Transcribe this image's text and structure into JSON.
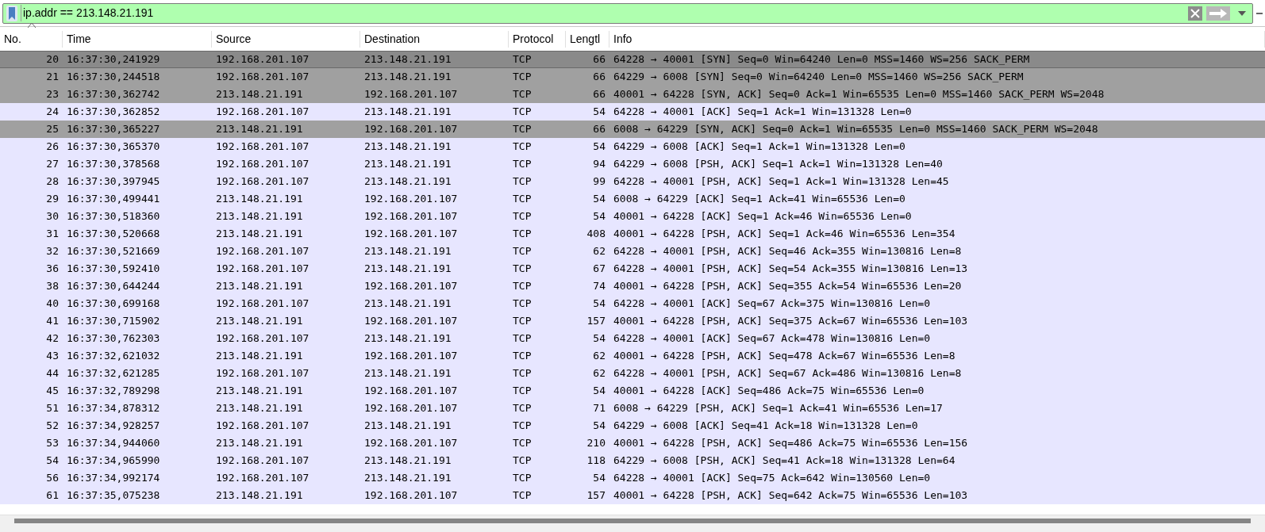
{
  "filter": {
    "value": "ip.addr == 213.148.21.191"
  },
  "table": {
    "columns": [
      "No.",
      "Time",
      "Source",
      "Destination",
      "Protocol",
      "Lengtl",
      "Info"
    ],
    "rows": [
      {
        "cells": [
          "20",
          "16:37:30,241929",
          "192.168.201.107",
          "213.148.21.191",
          "TCP",
          "66",
          "64228 → 40001 [SYN] Seq=0 Win=64240 Len=0 MSS=1460 WS=256 SACK_PERM"
        ],
        "color": "#8a8a8a",
        "selected": true
      },
      {
        "cells": [
          "21",
          "16:37:30,244518",
          "192.168.201.107",
          "213.148.21.191",
          "TCP",
          "66",
          "64229 → 6008 [SYN] Seq=0 Win=64240 Len=0 MSS=1460 WS=256 SACK_PERM"
        ],
        "color": "#a0a0a0",
        "selected": false
      },
      {
        "cells": [
          "23",
          "16:37:30,362742",
          "213.148.21.191",
          "192.168.201.107",
          "TCP",
          "66",
          "40001 → 64228 [SYN, ACK] Seq=0 Ack=1 Win=65535 Len=0 MSS=1460 SACK_PERM WS=2048"
        ],
        "color": "#a0a0a0",
        "selected": false
      },
      {
        "cells": [
          "24",
          "16:37:30,362852",
          "192.168.201.107",
          "213.148.21.191",
          "TCP",
          "54",
          "64228 → 40001 [ACK] Seq=1 Ack=1 Win=131328 Len=0"
        ],
        "color": "#e7e6ff",
        "selected": false
      },
      {
        "cells": [
          "25",
          "16:37:30,365227",
          "213.148.21.191",
          "192.168.201.107",
          "TCP",
          "66",
          "6008 → 64229 [SYN, ACK] Seq=0 Ack=1 Win=65535 Len=0 MSS=1460 SACK_PERM WS=2048"
        ],
        "color": "#a0a0a0",
        "selected": false
      },
      {
        "cells": [
          "26",
          "16:37:30,365370",
          "192.168.201.107",
          "213.148.21.191",
          "TCP",
          "54",
          "64229 → 6008 [ACK] Seq=1 Ack=1 Win=131328 Len=0"
        ],
        "color": "#e7e6ff",
        "selected": false
      },
      {
        "cells": [
          "27",
          "16:37:30,378568",
          "192.168.201.107",
          "213.148.21.191",
          "TCP",
          "94",
          "64229 → 6008 [PSH, ACK] Seq=1 Ack=1 Win=131328 Len=40"
        ],
        "color": "#e7e6ff",
        "selected": false
      },
      {
        "cells": [
          "28",
          "16:37:30,397945",
          "192.168.201.107",
          "213.148.21.191",
          "TCP",
          "99",
          "64228 → 40001 [PSH, ACK] Seq=1 Ack=1 Win=131328 Len=45"
        ],
        "color": "#e7e6ff",
        "selected": false
      },
      {
        "cells": [
          "29",
          "16:37:30,499441",
          "213.148.21.191",
          "192.168.201.107",
          "TCP",
          "54",
          "6008 → 64229 [ACK] Seq=1 Ack=41 Win=65536 Len=0"
        ],
        "color": "#e7e6ff",
        "selected": false
      },
      {
        "cells": [
          "30",
          "16:37:30,518360",
          "213.148.21.191",
          "192.168.201.107",
          "TCP",
          "54",
          "40001 → 64228 [ACK] Seq=1 Ack=46 Win=65536 Len=0"
        ],
        "color": "#e7e6ff",
        "selected": false
      },
      {
        "cells": [
          "31",
          "16:37:30,520668",
          "213.148.21.191",
          "192.168.201.107",
          "TCP",
          "408",
          "40001 → 64228 [PSH, ACK] Seq=1 Ack=46 Win=65536 Len=354"
        ],
        "color": "#e7e6ff",
        "selected": false
      },
      {
        "cells": [
          "32",
          "16:37:30,521669",
          "192.168.201.107",
          "213.148.21.191",
          "TCP",
          "62",
          "64228 → 40001 [PSH, ACK] Seq=46 Ack=355 Win=130816 Len=8"
        ],
        "color": "#e7e6ff",
        "selected": false
      },
      {
        "cells": [
          "36",
          "16:37:30,592410",
          "192.168.201.107",
          "213.148.21.191",
          "TCP",
          "67",
          "64228 → 40001 [PSH, ACK] Seq=54 Ack=355 Win=130816 Len=13"
        ],
        "color": "#e7e6ff",
        "selected": false
      },
      {
        "cells": [
          "38",
          "16:37:30,644244",
          "213.148.21.191",
          "192.168.201.107",
          "TCP",
          "74",
          "40001 → 64228 [PSH, ACK] Seq=355 Ack=54 Win=65536 Len=20"
        ],
        "color": "#e7e6ff",
        "selected": false
      },
      {
        "cells": [
          "40",
          "16:37:30,699168",
          "192.168.201.107",
          "213.148.21.191",
          "TCP",
          "54",
          "64228 → 40001 [ACK] Seq=67 Ack=375 Win=130816 Len=0"
        ],
        "color": "#e7e6ff",
        "selected": false
      },
      {
        "cells": [
          "41",
          "16:37:30,715902",
          "213.148.21.191",
          "192.168.201.107",
          "TCP",
          "157",
          "40001 → 64228 [PSH, ACK] Seq=375 Ack=67 Win=65536 Len=103"
        ],
        "color": "#e7e6ff",
        "selected": false
      },
      {
        "cells": [
          "42",
          "16:37:30,762303",
          "192.168.201.107",
          "213.148.21.191",
          "TCP",
          "54",
          "64228 → 40001 [ACK] Seq=67 Ack=478 Win=130816 Len=0"
        ],
        "color": "#e7e6ff",
        "selected": false
      },
      {
        "cells": [
          "43",
          "16:37:32,621032",
          "213.148.21.191",
          "192.168.201.107",
          "TCP",
          "62",
          "40001 → 64228 [PSH, ACK] Seq=478 Ack=67 Win=65536 Len=8"
        ],
        "color": "#e7e6ff",
        "selected": false
      },
      {
        "cells": [
          "44",
          "16:37:32,621285",
          "192.168.201.107",
          "213.148.21.191",
          "TCP",
          "62",
          "64228 → 40001 [PSH, ACK] Seq=67 Ack=486 Win=130816 Len=8"
        ],
        "color": "#e7e6ff",
        "selected": false
      },
      {
        "cells": [
          "45",
          "16:37:32,789298",
          "213.148.21.191",
          "192.168.201.107",
          "TCP",
          "54",
          "40001 → 64228 [ACK] Seq=486 Ack=75 Win=65536 Len=0"
        ],
        "color": "#e7e6ff",
        "selected": false
      },
      {
        "cells": [
          "51",
          "16:37:34,878312",
          "213.148.21.191",
          "192.168.201.107",
          "TCP",
          "71",
          "6008 → 64229 [PSH, ACK] Seq=1 Ack=41 Win=65536 Len=17"
        ],
        "color": "#e7e6ff",
        "selected": false
      },
      {
        "cells": [
          "52",
          "16:37:34,928257",
          "192.168.201.107",
          "213.148.21.191",
          "TCP",
          "54",
          "64229 → 6008 [ACK] Seq=41 Ack=18 Win=131328 Len=0"
        ],
        "color": "#e7e6ff",
        "selected": false
      },
      {
        "cells": [
          "53",
          "16:37:34,944060",
          "213.148.21.191",
          "192.168.201.107",
          "TCP",
          "210",
          "40001 → 64228 [PSH, ACK] Seq=486 Ack=75 Win=65536 Len=156"
        ],
        "color": "#e7e6ff",
        "selected": false
      },
      {
        "cells": [
          "54",
          "16:37:34,965990",
          "192.168.201.107",
          "213.148.21.191",
          "TCP",
          "118",
          "64229 → 6008 [PSH, ACK] Seq=41 Ack=18 Win=131328 Len=64"
        ],
        "color": "#e7e6ff",
        "selected": false
      },
      {
        "cells": [
          "56",
          "16:37:34,992174",
          "192.168.201.107",
          "213.148.21.191",
          "TCP",
          "54",
          "64228 → 40001 [ACK] Seq=75 Ack=642 Win=130560 Len=0"
        ],
        "color": "#e7e6ff",
        "selected": false
      },
      {
        "cells": [
          "61",
          "16:37:35,075238",
          "213.148.21.191",
          "192.168.201.107",
          "TCP",
          "157",
          "40001 → 64228 [PSH, ACK] Seq=642 Ack=75 Win=65536 Len=103"
        ],
        "color": "#e7e6ff",
        "selected": false
      }
    ]
  }
}
